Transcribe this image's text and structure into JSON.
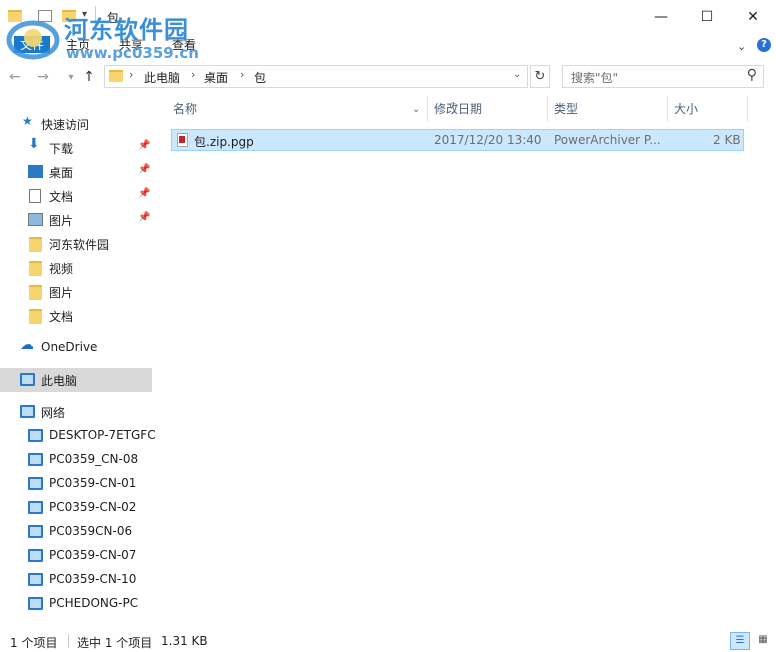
{
  "window": {
    "title": "包",
    "minimize_glyph": "—",
    "maximize_glyph": "☐",
    "close_glyph": "✕"
  },
  "ribbon": {
    "tabs": [
      "文件",
      "主页",
      "共享",
      "查看"
    ]
  },
  "watermark": {
    "title": "河东软件园",
    "url": "www.pc0359.cn"
  },
  "address": {
    "crumbs": [
      "此电脑",
      "桌面",
      "包"
    ],
    "search_placeholder": "搜索\"包\""
  },
  "sidebar": {
    "quick_access": "快速访问",
    "pinned": [
      "下载",
      "桌面",
      "文档",
      "图片"
    ],
    "folders": [
      "河东软件园",
      "视频",
      "图片",
      "文档"
    ],
    "onedrive": "OneDrive",
    "this_pc": "此电脑",
    "network": "网络",
    "computers": [
      "DESKTOP-7ETGFC",
      "PC0359_CN-08",
      "PC0359-CN-01",
      "PC0359-CN-02",
      "PC0359CN-06",
      "PC0359-CN-07",
      "PC0359-CN-10",
      "PCHEDONG-PC"
    ]
  },
  "columns": {
    "name": "名称",
    "date": "修改日期",
    "type": "类型",
    "size": "大小"
  },
  "files": [
    {
      "name": "包.zip.pgp",
      "date": "2017/12/20 13:40",
      "type": "PowerArchiver P...",
      "size": "2 KB"
    }
  ],
  "status": {
    "item_count": "1 个项目",
    "selected": "选中 1 个项目",
    "selected_size": "1.31 KB"
  },
  "colors": {
    "accent": "#0078d7",
    "selection": "#cce8ff",
    "watermark": "#3a8fd8"
  }
}
